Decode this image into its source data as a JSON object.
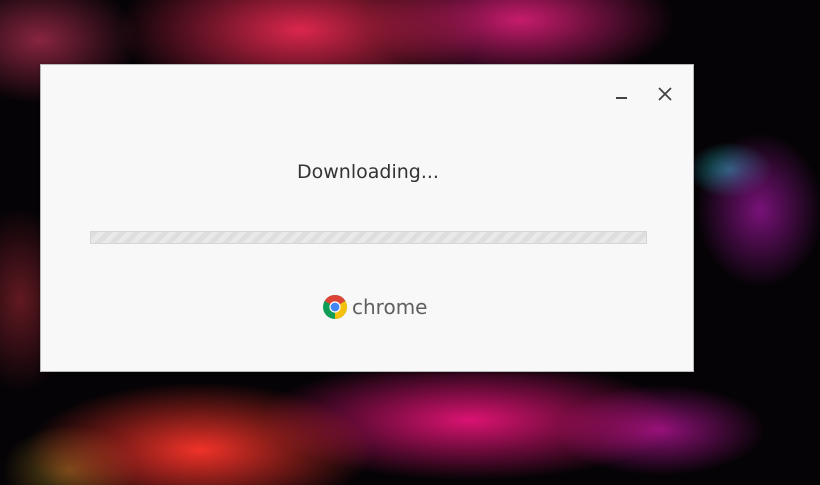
{
  "dialog": {
    "status_text": "Downloading...",
    "progress_fraction": 0,
    "brand_label": "chrome",
    "icons": {
      "minimize": "minimize-icon",
      "close": "close-icon",
      "logo": "chrome-logo-icon"
    }
  },
  "colors": {
    "dialog_background": "#f8f8f8",
    "status_text": "#333333",
    "brand_text": "#5f5f5f",
    "logo_red": "#db4437",
    "logo_yellow": "#f4c20d",
    "logo_green": "#0f9d58",
    "logo_blue": "#4285f4"
  }
}
